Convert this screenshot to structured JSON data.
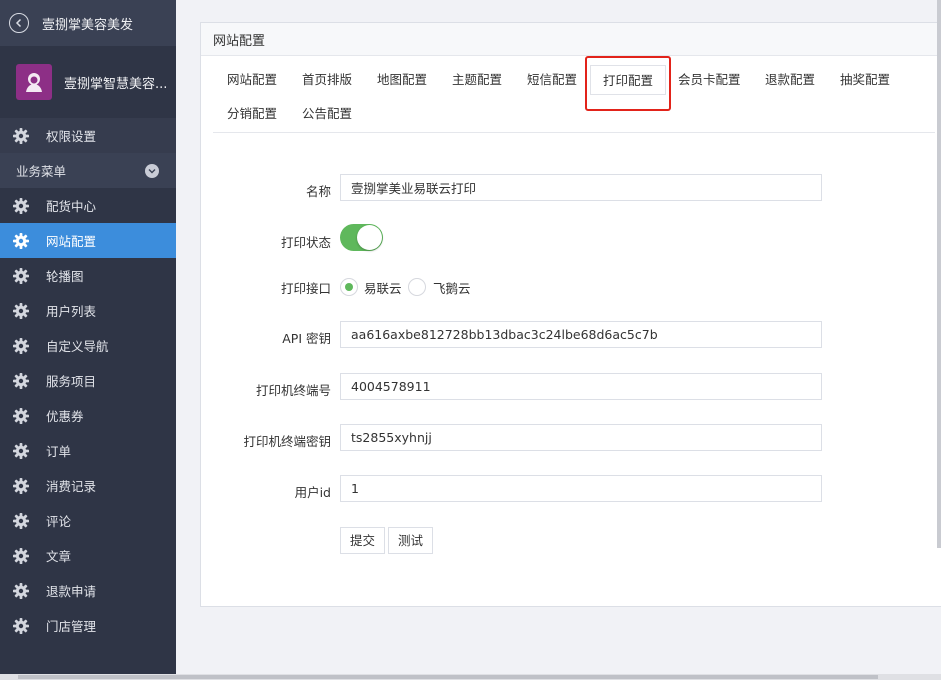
{
  "sidebar": {
    "header_title": "壹捌掌美容美发",
    "profile_name": "壹捌掌智慧美容...",
    "top_item": "权限设置",
    "section_title": "业务菜单",
    "items": [
      "配货中心",
      "网站配置",
      "轮播图",
      "用户列表",
      "自定义导航",
      "服务项目",
      "优惠券",
      "订单",
      "消费记录",
      "评论",
      "文章",
      "退款申请",
      "门店管理"
    ],
    "active_item": "网站配置"
  },
  "panel": {
    "title": "网站配置",
    "tabs": [
      "网站配置",
      "首页排版",
      "地图配置",
      "主题配置",
      "短信配置",
      "打印配置",
      "会员卡配置",
      "退款配置",
      "抽奖配置",
      "分销配置",
      "公告配置"
    ],
    "active_tab": "打印配置"
  },
  "form": {
    "name_label": "名称",
    "name_value": "壹捌掌美业易联云打印",
    "status_label": "打印状态",
    "status_on": true,
    "interface_label": "打印接口",
    "interface_options": [
      "易联云",
      "飞鹅云"
    ],
    "interface_selected": "易联云",
    "api_key_label": "API 密钥",
    "api_key_value": "aa616axbe812728bb13dbac3c24lbe68d6ac5c7b",
    "terminal_no_label": "打印机终端号",
    "terminal_no_value": "4004578911",
    "terminal_key_label": "打印机终端密钥",
    "terminal_key_value": "ts2855xyhnjj",
    "user_id_label": "用户id",
    "user_id_value": "1",
    "submit_label": "提交",
    "test_label": "测试"
  },
  "colors": {
    "sidebar_bg": "#2f3546",
    "active_bg": "#3c8ddc",
    "toggle_on": "#5fb85c",
    "highlight_border": "#e2231a"
  }
}
